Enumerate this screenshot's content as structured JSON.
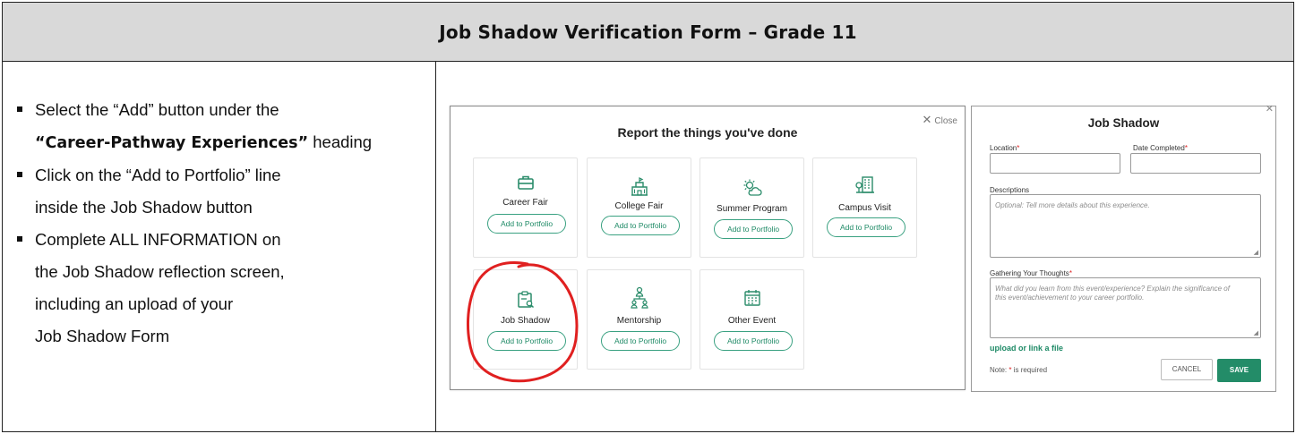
{
  "title": "Job Shadow Verification Form – Grade 11",
  "instructions": {
    "b1_line1": "Select the “Add” button under the",
    "b1_line2_bold": "“Career-Pathway Experiences”",
    "b1_line2_rest": " heading",
    "b2_line1": "Click on the “Add to Portfolio” line",
    "b2_line2": "inside the Job Shadow button",
    "b3_line1": "Complete ALL INFORMATION on",
    "b3_line2": "the Job Shadow reflection screen,",
    "b3_line3": "including an upload of your",
    "b3_line4": "Job Shadow Form"
  },
  "report_modal": {
    "title": "Report the things you've done",
    "close_label": "Close",
    "add_label": "Add to Portfolio",
    "cards": [
      {
        "label": "Career Fair",
        "icon": "briefcase-icon"
      },
      {
        "label": "College Fair",
        "icon": "college-building-icon"
      },
      {
        "label": "Summer Program",
        "icon": "sun-cloud-icon"
      },
      {
        "label": "Campus Visit",
        "icon": "campus-building-icon"
      },
      {
        "label": "Job Shadow",
        "icon": "clipboard-search-icon"
      },
      {
        "label": "Mentorship",
        "icon": "people-hierarchy-icon"
      },
      {
        "label": "Other Event",
        "icon": "calendar-icon"
      }
    ],
    "highlight_color": "#e02020"
  },
  "job_shadow_modal": {
    "title": "Job Shadow",
    "location_label": "Location",
    "date_label": "Date Completed",
    "descriptions_label": "Descriptions",
    "descriptions_placeholder": "Optional: Tell more details about this experience.",
    "thoughts_label": "Gathering Your Thoughts",
    "thoughts_placeholder_1": "What did you learn from this event/experience? Explain the significance of",
    "thoughts_placeholder_2": "this event/achievement to your career portfolio.",
    "upload_link": "upload or link a file",
    "note_prefix": "Note: ",
    "note_suffix": " is required",
    "required_mark": "*",
    "cancel_label": "CANCEL",
    "save_label": "SAVE",
    "accent_color": "#238c68"
  }
}
